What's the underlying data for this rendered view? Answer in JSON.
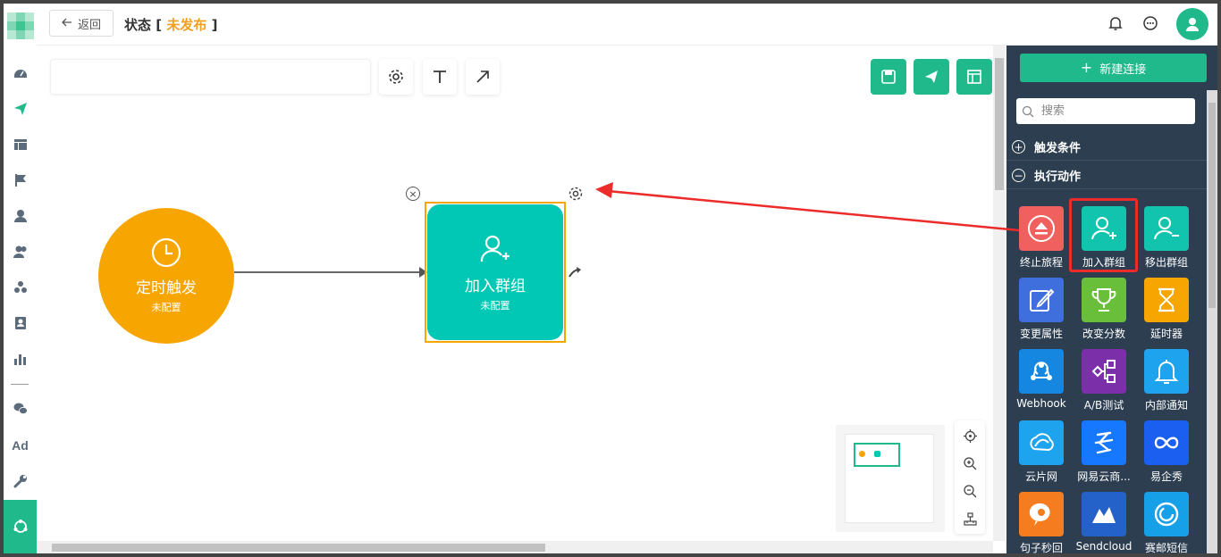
{
  "header": {
    "back_label": "返回",
    "title": "状态",
    "bracket_open": "[",
    "status": "未发布",
    "bracket_close": "]"
  },
  "left_nav": {
    "ad_label": "Ad",
    "icons": [
      "dashboard-icon",
      "send-icon",
      "layout-icon",
      "flag-icon",
      "user-icon",
      "users-icon",
      "group-icon",
      "contact-card-icon",
      "bar-chart-icon",
      "wechat-icon",
      "wrench-icon",
      "workflow-icon"
    ]
  },
  "canvas": {
    "name_placeholder": "",
    "nodes": [
      {
        "title": "定时触发",
        "subtitle": "未配置",
        "color": "#f7a500",
        "icon": "clock-icon"
      },
      {
        "title": "加入群组",
        "subtitle": "未配置",
        "color": "#00c8b4",
        "icon": "user-plus-icon"
      }
    ],
    "close_glyph": "×"
  },
  "panel": {
    "new_connection_label": "新建连接",
    "search_placeholder": "搜索",
    "sections": [
      {
        "label": "触发条件",
        "state": "collapsed",
        "glyph": "+"
      },
      {
        "label": "执行动作",
        "state": "expanded",
        "glyph": "−"
      }
    ],
    "tiles": [
      {
        "label": "终止旅程",
        "color": "#f0605e",
        "icon": "eject-icon"
      },
      {
        "label": "加入群组",
        "color": "#12c3ae",
        "icon": "user-plus-icon",
        "highlighted": true
      },
      {
        "label": "移出群组",
        "color": "#12c3ae",
        "icon": "user-minus-icon"
      },
      {
        "label": "变更属性",
        "color": "#3f6fdc",
        "icon": "edit-icon"
      },
      {
        "label": "改变分数",
        "color": "#6abf3a",
        "icon": "trophy-icon"
      },
      {
        "label": "延时器",
        "color": "#f7a500",
        "icon": "hourglass-icon"
      },
      {
        "label": "Webhook",
        "color": "#1687e0",
        "icon": "webhook-icon"
      },
      {
        "label": "A/B测试",
        "color": "#7b2fa8",
        "icon": "ab-test-icon"
      },
      {
        "label": "内部通知",
        "color": "#1ea3ee",
        "icon": "bell-icon"
      },
      {
        "label": "云片网",
        "color": "#1ea3ee",
        "icon": "cloud-icon"
      },
      {
        "label": "网易云商...",
        "color": "#1677ff",
        "icon": "netease-icon"
      },
      {
        "label": "易企秀",
        "color": "#1a5ff0",
        "icon": "infinity-icon"
      },
      {
        "label": "句子秒回",
        "color": "#f57c1f",
        "icon": "chat-bubble-icon"
      },
      {
        "label": "Sendcloud",
        "color": "#2461c9",
        "icon": "sendcloud-icon"
      },
      {
        "label": "赛邮短信",
        "color": "#16a0e8",
        "icon": "spiral-icon"
      }
    ]
  },
  "colors": {
    "accent": "#1fb98b",
    "status": "#f0a01e",
    "annotation": "#ec2b2b",
    "panel_bg": "#2c3e50"
  }
}
